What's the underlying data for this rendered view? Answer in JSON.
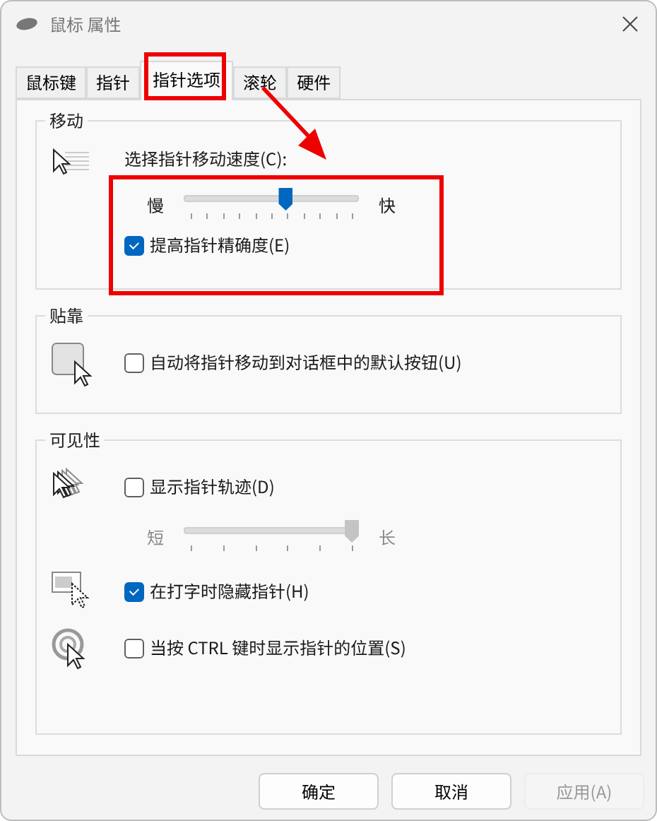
{
  "window": {
    "title": "鼠标 属性"
  },
  "tabs": [
    {
      "label": "鼠标键",
      "selected": false
    },
    {
      "label": "指针",
      "selected": false
    },
    {
      "label": "指针选项",
      "selected": true
    },
    {
      "label": "滚轮",
      "selected": false
    },
    {
      "label": "硬件",
      "selected": false
    }
  ],
  "groups": [
    {
      "title": "移动",
      "rows": [
        {
          "kind": "slider",
          "label": "选择指针移动速度(C):",
          "min_label": "慢",
          "max_label": "快",
          "level": 0.59,
          "disabled": false
        },
        {
          "kind": "checkbox",
          "label": "提高指针精确度(E)",
          "checked": true
        }
      ]
    },
    {
      "title": "贴靠",
      "rows": [
        {
          "kind": "checkbox",
          "label": "自动将指针移动到对话框中的默认按钮(U)",
          "checked": false
        }
      ]
    },
    {
      "title": "可见性",
      "rows": [
        {
          "kind": "checkbox",
          "label": "显示指针轨迹(D)",
          "checked": false
        },
        {
          "kind": "slider",
          "min_label": "短",
          "max_label": "长",
          "level": 1,
          "disabled": true
        },
        {
          "kind": "checkbox",
          "label": "在打字时隐藏指针(H)",
          "checked": true
        },
        {
          "kind": "checkbox",
          "label": "当按 CTRL 键时显示指针的位置(S)",
          "checked": false
        }
      ]
    }
  ],
  "buttons": [
    {
      "label": "确定",
      "disabled": false
    },
    {
      "label": "取消",
      "disabled": false
    },
    {
      "label": "应用(A)",
      "disabled": true
    }
  ],
  "annotations": [
    {
      "kind": "box"
    },
    {
      "kind": "arrow"
    },
    {
      "kind": "box"
    }
  ]
}
